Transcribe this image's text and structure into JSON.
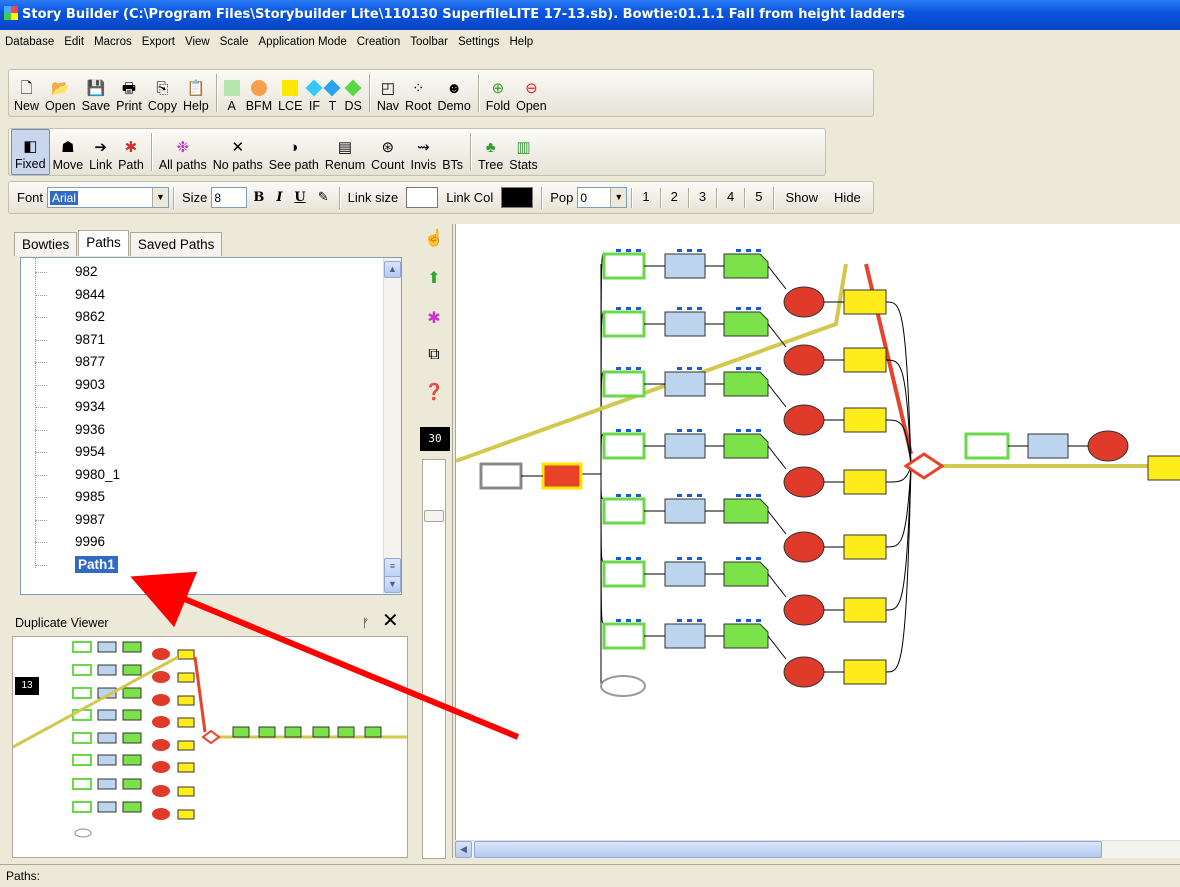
{
  "window": {
    "title": "Story Builder (C:\\Program Files\\Storybuilder Lite\\110130 SuperfileLITE 17-13.sb).  Bowtie:01.1.1 Fall from height ladders"
  },
  "menu": [
    "Database",
    "Edit",
    "Macros",
    "Export",
    "View",
    "Scale",
    "Application Mode",
    "Creation",
    "Toolbar",
    "Settings",
    "Help"
  ],
  "toolbar1": {
    "file": [
      {
        "label": "New",
        "icon": "new-file-icon"
      },
      {
        "label": "Open",
        "icon": "open-folder-icon"
      },
      {
        "label": "Save",
        "icon": "save-disk-icon"
      },
      {
        "label": "Print",
        "icon": "printer-icon"
      },
      {
        "label": "Copy",
        "icon": "copy-icon"
      },
      {
        "label": "Help",
        "icon": "clipboard-help-icon"
      }
    ],
    "nodes": [
      {
        "label": "A",
        "color": "#b8e6b0"
      },
      {
        "label": "BFM",
        "color": "#f5a04a"
      },
      {
        "label": "LCE",
        "color": "#ffe800"
      },
      {
        "label": "IF",
        "color": "#34c8f5"
      },
      {
        "label": "T",
        "color": "#2aa2f0"
      },
      {
        "label": "DS",
        "color": "#58d84a"
      }
    ],
    "nav": [
      {
        "label": "Nav",
        "icon": "nav-icon"
      },
      {
        "label": "Root",
        "icon": "root-icon"
      },
      {
        "label": "Demo",
        "icon": "demo-icon"
      }
    ],
    "fold": [
      {
        "label": "Fold",
        "icon": "fold-plus-icon"
      },
      {
        "label": "Open",
        "icon": "open-minus-icon"
      }
    ]
  },
  "toolbar2": {
    "mode": [
      {
        "label": "Fixed",
        "icon": "fixed-icon"
      },
      {
        "label": "Move",
        "icon": "move-icon"
      },
      {
        "label": "Link",
        "icon": "link-arrow-icon"
      },
      {
        "label": "Path",
        "icon": "path-bug-icon"
      }
    ],
    "paths": [
      {
        "label": "All paths",
        "icon": "all-paths-icon"
      },
      {
        "label": "No paths",
        "icon": "no-paths-icon"
      },
      {
        "label": "See path",
        "icon": "see-path-icon"
      },
      {
        "label": "Renum",
        "icon": "renum-icon"
      },
      {
        "label": "Count",
        "icon": "count-icon"
      },
      {
        "label": "Invis",
        "icon": "invis-icon"
      },
      {
        "label": "BTs",
        "icon": "bts-icon"
      }
    ],
    "stats": [
      {
        "label": "Tree",
        "icon": "tree-icon"
      },
      {
        "label": "Stats",
        "icon": "stats-icon"
      }
    ]
  },
  "toolbar3": {
    "font_label": "Font",
    "font_value": "Arial",
    "size_label": "Size",
    "size_value": "8",
    "bold": "B",
    "italic": "I",
    "underline": "U",
    "link_size_label": "Link size",
    "link_col_label": "Link Col",
    "link_col_color": "#000000",
    "pop_label": "Pop",
    "pop_value": "0",
    "levels": [
      "1",
      "2",
      "3",
      "4",
      "5"
    ],
    "show": "Show",
    "hide": "Hide"
  },
  "left_tabs": [
    "Bowties",
    "Paths",
    "Saved Paths"
  ],
  "paths_list": [
    "982",
    "9844",
    "9862",
    "9871",
    "9877",
    "9903",
    "9934",
    "9936",
    "9954",
    "9980_1",
    "9985",
    "9987",
    "9996",
    "Path1"
  ],
  "selected_path": "Path1",
  "duplicate_viewer": {
    "title": "Duplicate Viewer",
    "zoom": "13"
  },
  "canvas": {
    "zoom": "30"
  },
  "status": "Paths:",
  "annotation": {
    "color": "#ff0000"
  }
}
